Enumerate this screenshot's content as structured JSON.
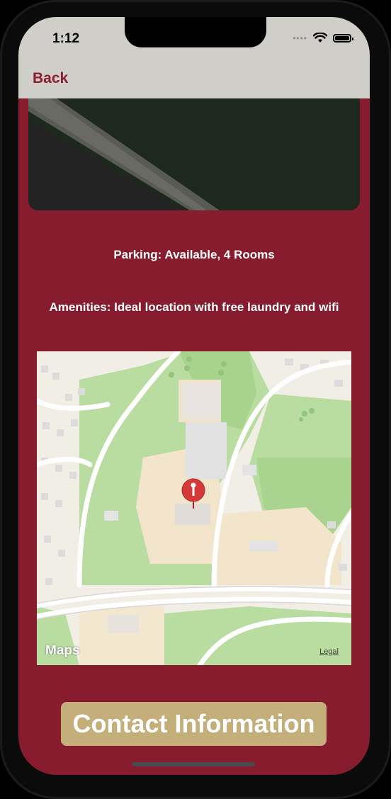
{
  "status_bar": {
    "time": "1:12",
    "signal_icon": "signal-dots-icon",
    "wifi_icon": "wifi-icon",
    "battery_icon": "battery-icon"
  },
  "nav": {
    "back_label": "Back"
  },
  "details": {
    "parking": "Parking:   Available,         4  Rooms",
    "amenities": "Amenities: Ideal location with free laundry and wifi"
  },
  "map": {
    "attribution": "Maps",
    "legal": "Legal",
    "pin_icon": "map-pin-icon"
  },
  "actions": {
    "contact_label": "Contact Information"
  },
  "colors": {
    "background": "#861c2e",
    "nav_bar": "#cfcec9",
    "button": "#c4ae7a",
    "accent": "#8d1d30"
  }
}
